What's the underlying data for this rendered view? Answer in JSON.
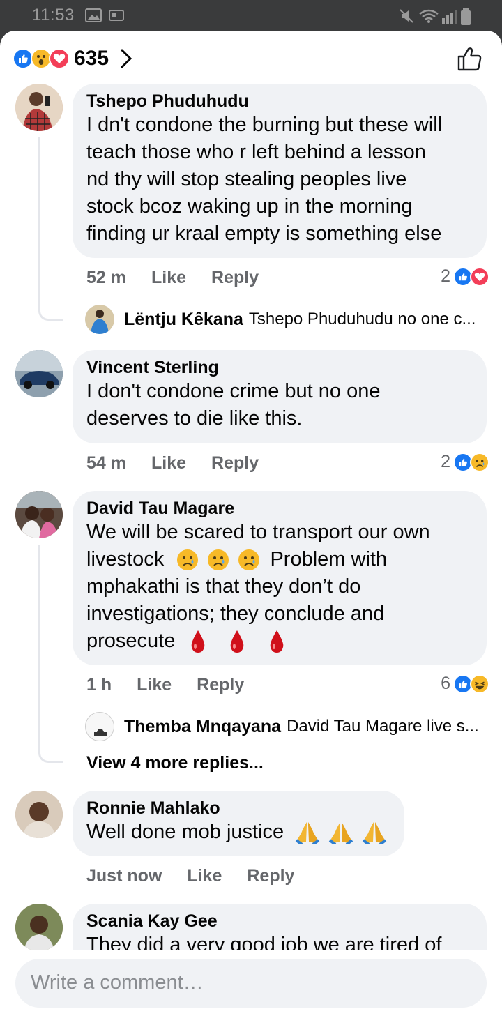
{
  "status_bar": {
    "time": "11:53"
  },
  "header": {
    "reaction_count": "635",
    "reaction_icons": [
      "like-reaction",
      "wow-reaction",
      "love-reaction"
    ]
  },
  "comments": [
    {
      "author": "Tshepo Phuduhudu",
      "lines": [
        "I dn't condone the burning but these will",
        "teach those who r left behind a lesson",
        "nd thy will stop stealing peoples live",
        "stock bcoz waking up in the morning",
        "finding ur kraal empty is something else"
      ],
      "time": "52 m",
      "like": "Like",
      "reply": "Reply",
      "reaction_count": "2",
      "reply_preview": {
        "name": "Lëntju Kêkana",
        "text": "Tshepo Phuduhudu no one c..."
      }
    },
    {
      "author": "Vincent Sterling",
      "lines": [
        "I don't condone crime but no one",
        "deserves to die like this."
      ],
      "time": "54 m",
      "like": "Like",
      "reply": "Reply",
      "reaction_count": "2"
    },
    {
      "author": "David Tau  Magare",
      "lines": [
        "We will be scared to transport our own",
        "livestock",
        "Problem with",
        "mphakathi is that they don’t do",
        "investigations; they conclude and",
        "prosecute"
      ],
      "time": "1 h",
      "like": "Like",
      "reply": "Reply",
      "reaction_count": "6",
      "reply_preview": {
        "name": "Themba Mnqayana",
        "text": "David Tau Magare live s..."
      },
      "view_more": "View 4 more replies..."
    },
    {
      "author": "Ronnie Mahlako",
      "lines": [
        "Well done mob justice"
      ],
      "time": "Just now",
      "like": "Like",
      "reply": "Reply"
    },
    {
      "author": "Scania Kay Gee",
      "lines": [
        "They did a very good job we are tired of"
      ]
    }
  ],
  "composer": {
    "placeholder": "Write a comment…"
  },
  "colors": {
    "like_blue": "#1877f2",
    "love_red": "#f33e58",
    "haha_yellow": "#f7b928",
    "bubble": "#f0f2f5",
    "meta_gray": "#65676b"
  }
}
